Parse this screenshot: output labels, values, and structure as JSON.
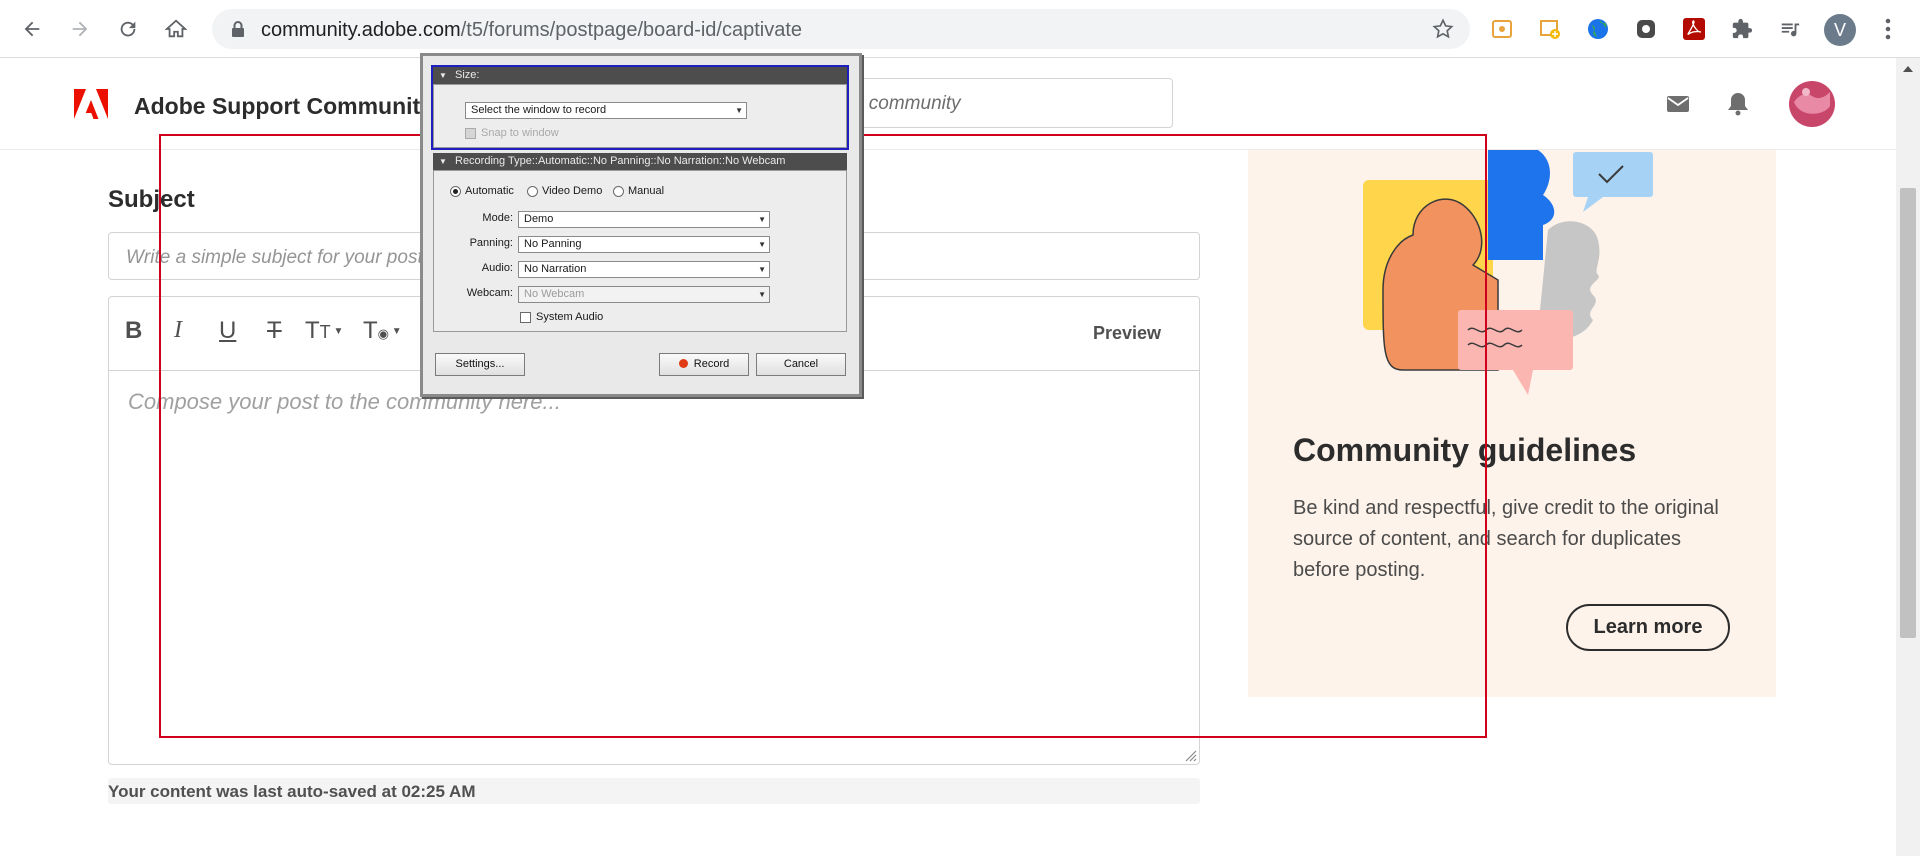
{
  "browser": {
    "url_host": "community.adobe.com",
    "url_path": "/t5/forums/postpage/board-id/captivate",
    "profile_initial": "V"
  },
  "site": {
    "title": "Adobe Support Community",
    "search_placeholder_visible": "s community"
  },
  "editor": {
    "subject_label": "Subject",
    "subject_placeholder": "Write a simple subject for your post. K",
    "bold": "B",
    "italic": "I",
    "underline": "U",
    "strike": "T",
    "font_size": "T",
    "font_style": "T",
    "preview_label": "Preview",
    "body_placeholder": "Compose your post to the community here...",
    "autosave_text": "Your content was last auto-saved at 02:25 AM"
  },
  "guidelines": {
    "title": "Community guidelines",
    "body": "Be kind and respectful, give credit to the original source of content, and search for duplicates before posting.",
    "learn_more": "Learn more"
  },
  "captivate_dialog": {
    "size_header": "Size:",
    "window_select": "Select the window to record",
    "snap_label": "Snap to window",
    "recording_type_header": "Recording Type::Automatic::No Panning::No Narration::No Webcam",
    "mode_options": [
      "Automatic",
      "Video Demo",
      "Manual"
    ],
    "mode_label": "Mode:",
    "mode_value": "Demo",
    "panning_label": "Panning:",
    "panning_value": "No Panning",
    "audio_label": "Audio:",
    "audio_value": "No Narration",
    "webcam_label": "Webcam:",
    "webcam_value": "No Webcam",
    "system_audio_label": "System Audio",
    "settings_button": "Settings...",
    "record_button": "Record",
    "cancel_button": "Cancel"
  },
  "colors": {
    "adobe_red": "#eb1000",
    "record_frame": "#d0021b",
    "size_outline": "#1f1fbf",
    "card_bg": "#fdf3ea"
  }
}
